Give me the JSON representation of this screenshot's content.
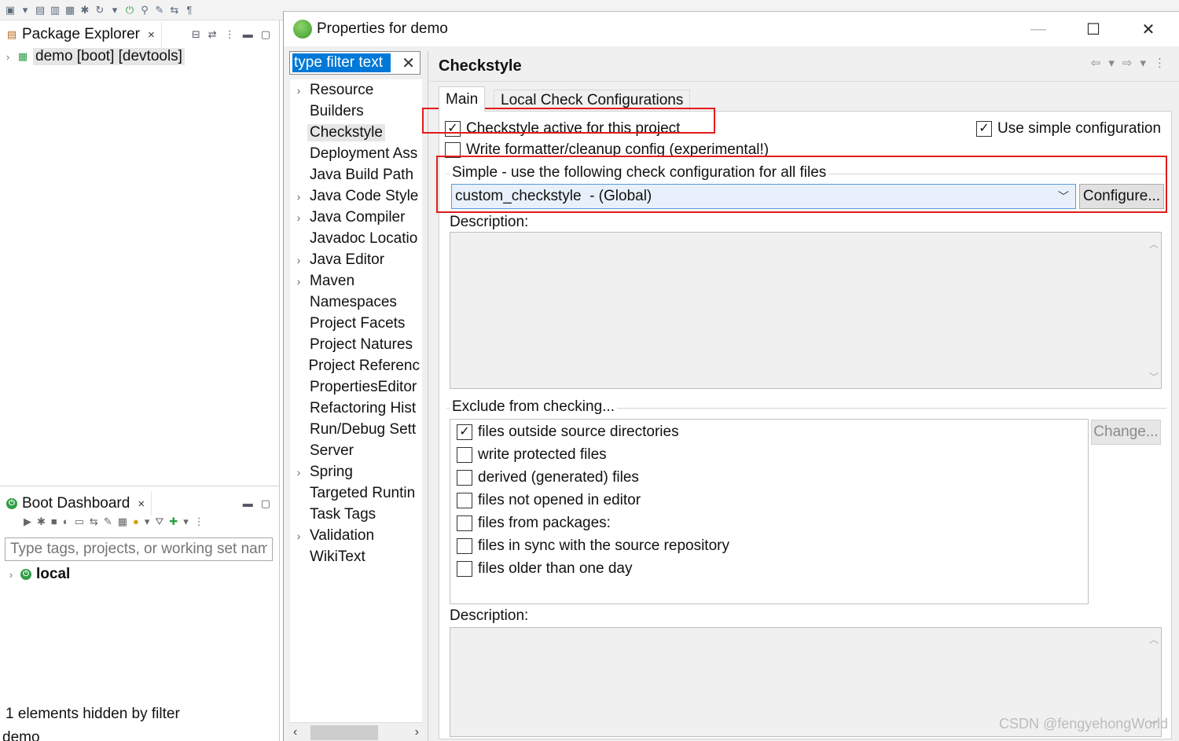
{
  "workbench": {
    "package_explorer": {
      "tab_label": "Package Explorer",
      "project": "demo [boot] [devtools]"
    },
    "boot_dashboard": {
      "tab_label": "Boot Dashboard",
      "search_placeholder": "Type tags, projects, or working set nam",
      "item": "local",
      "status": "1 elements hidden by filter"
    },
    "status_bar_text": "demo"
  },
  "dialog": {
    "title": "Properties for demo",
    "filter_value": "type filter text",
    "nav_items": [
      {
        "label": "Resource",
        "expandable": true
      },
      {
        "label": "Builders",
        "expandable": false
      },
      {
        "label": "Checkstyle",
        "expandable": false,
        "selected": true
      },
      {
        "label": "Deployment Ass",
        "expandable": false
      },
      {
        "label": "Java Build Path",
        "expandable": false
      },
      {
        "label": "Java Code Style",
        "expandable": true
      },
      {
        "label": "Java Compiler",
        "expandable": true
      },
      {
        "label": "Javadoc Locatio",
        "expandable": false
      },
      {
        "label": "Java Editor",
        "expandable": true
      },
      {
        "label": "Maven",
        "expandable": true
      },
      {
        "label": "Namespaces",
        "expandable": false
      },
      {
        "label": "Project Facets",
        "expandable": false
      },
      {
        "label": "Project Natures",
        "expandable": false
      },
      {
        "label": "Project Referenc",
        "expandable": false
      },
      {
        "label": "PropertiesEditor",
        "expandable": false
      },
      {
        "label": "Refactoring Hist",
        "expandable": false
      },
      {
        "label": "Run/Debug Sett",
        "expandable": false
      },
      {
        "label": "Server",
        "expandable": false
      },
      {
        "label": "Spring",
        "expandable": true
      },
      {
        "label": "Targeted Runtin",
        "expandable": false
      },
      {
        "label": "Task Tags",
        "expandable": false
      },
      {
        "label": "Validation",
        "expandable": true
      },
      {
        "label": "WikiText",
        "expandable": false
      }
    ],
    "page": {
      "title": "Checkstyle",
      "tabs": [
        "Main",
        "Local Check Configurations"
      ],
      "active_checkbox": {
        "label": "Checkstyle active for this project",
        "checked": true
      },
      "simple_checkbox": {
        "label": "Use simple configuration",
        "checked": true
      },
      "formatter_checkbox": {
        "label": "Write formatter/cleanup config (experimental!)",
        "checked": false
      },
      "simple_group_title": "Simple - use the following check configuration for all files",
      "config_value": "custom_checkstyle  - (Global)",
      "configure_button": "Configure...",
      "description_label": "Description:",
      "exclude_group_title": "Exclude from checking...",
      "exclude_items": [
        {
          "label": "files outside source directories",
          "checked": true
        },
        {
          "label": "write protected files",
          "checked": false
        },
        {
          "label": "derived (generated) files",
          "checked": false
        },
        {
          "label": "files not opened in editor",
          "checked": false
        },
        {
          "label": "files from packages:",
          "checked": false
        },
        {
          "label": "files in sync with the source repository",
          "checked": false
        },
        {
          "label": "files older than one day",
          "checked": false
        }
      ],
      "change_button": "Change...",
      "description_label_2": "Description:"
    }
  },
  "watermark": "CSDN @fengyehongWorld",
  "colors": {
    "selection_blue": "#0078d7",
    "highlight_red": "#e21b1b",
    "spring_green": "#2f9e44"
  }
}
